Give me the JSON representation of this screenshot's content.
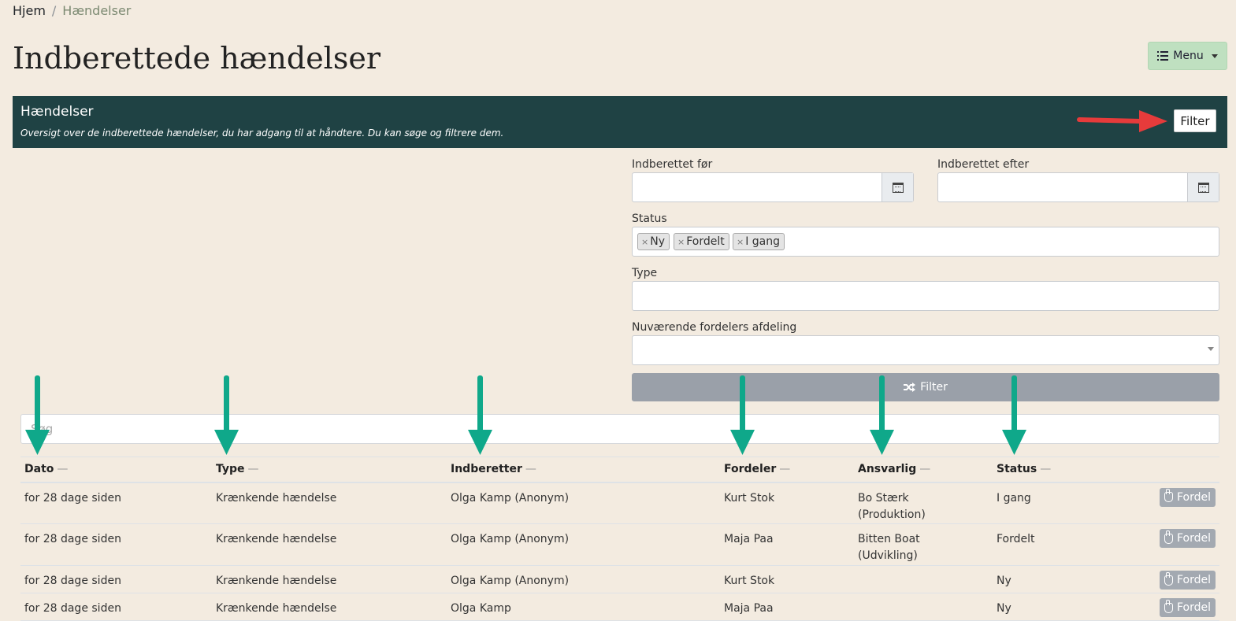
{
  "breadcrumb": {
    "home": "Hjem",
    "separator": "/",
    "current": "Hændelser"
  },
  "page_title": "Indberettede hændelser",
  "menu": {
    "label": "Menu",
    "icon": "list-icon"
  },
  "panel": {
    "title": "Hændelser",
    "description": "Oversigt over de indberettede hændelser, du har adgang til at håndtere. Du kan søge og filtrere dem.",
    "filter_toggle": "Filter"
  },
  "filters": {
    "reported_before": {
      "label": "Indberettet før",
      "value": ""
    },
    "reported_after": {
      "label": "Indberettet efter",
      "value": ""
    },
    "status": {
      "label": "Status",
      "tags": [
        "Ny",
        "Fordelt",
        "I gang"
      ],
      "remove_symbol": "×"
    },
    "type": {
      "label": "Type",
      "value": ""
    },
    "department": {
      "label": "Nuværende fordelers afdeling",
      "value": ""
    },
    "submit_label": "Filter",
    "submit_icon": "shuffle-icon"
  },
  "search": {
    "placeholder": "Søg"
  },
  "table": {
    "sort_symbol": "—",
    "columns": [
      "Dato",
      "Type",
      "Indberetter",
      "Fordeler",
      "Ansvarlig",
      "Status"
    ],
    "action_label": "Fordel",
    "rows": [
      {
        "dato": "for 28 dage siden",
        "type": "Krænkende hændelse",
        "indberetter": "Olga Kamp (Anonym)",
        "fordeler": "Kurt Stok",
        "ansvarlig": "Bo Stærk",
        "ansvarlig_afd": "(Produktion)",
        "status": "I gang"
      },
      {
        "dato": "for 28 dage siden",
        "type": "Krænkende hændelse",
        "indberetter": "Olga Kamp (Anonym)",
        "fordeler": "Maja Paa",
        "ansvarlig": "Bitten Boat",
        "ansvarlig_afd": "(Udvikling)",
        "status": "Fordelt"
      },
      {
        "dato": "for 28 dage siden",
        "type": "Krænkende hændelse",
        "indberetter": "Olga Kamp (Anonym)",
        "fordeler": "Kurt Stok",
        "ansvarlig": "",
        "ansvarlig_afd": "",
        "status": "Ny"
      },
      {
        "dato": "for 28 dage siden",
        "type": "Krænkende hændelse",
        "indberetter": "Olga Kamp",
        "fordeler": "Maja Paa",
        "ansvarlig": "",
        "ansvarlig_afd": "",
        "status": "Ny"
      }
    ]
  },
  "colors": {
    "panel_header": "#1f4244",
    "menu_button": "#bfe0c0",
    "annotation_red": "#e63b3b",
    "annotation_green": "#0fa88a"
  }
}
